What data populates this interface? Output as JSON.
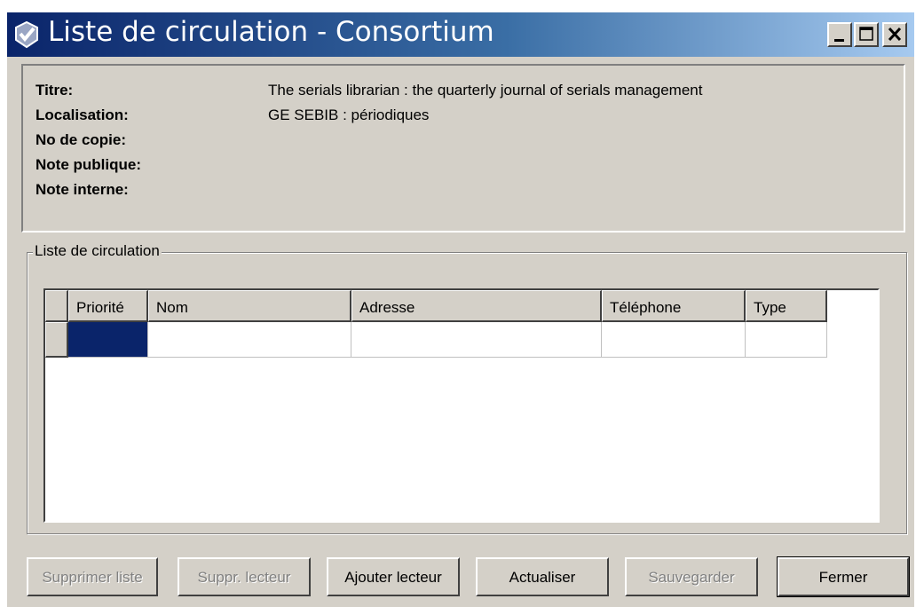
{
  "window": {
    "title": "Liste de circulation - Consortium"
  },
  "info": {
    "fields": [
      {
        "label": "Titre:",
        "value": "The serials librarian : the quarterly journal of serials management"
      },
      {
        "label": "Localisation:",
        "value": "GE SEBIB : périodiques"
      },
      {
        "label": "No de copie:",
        "value": ""
      },
      {
        "label": "Note publique:",
        "value": ""
      },
      {
        "label": "Note interne:",
        "value": ""
      }
    ]
  },
  "circulation": {
    "group_title": "Liste de circulation",
    "columns": [
      "Priorité",
      "Nom",
      "Adresse",
      "Téléphone",
      "Type"
    ],
    "rows": [
      [
        "",
        "",
        "",
        "",
        ""
      ]
    ],
    "selection_color": "#0a246a"
  },
  "buttons": [
    {
      "label": "Supprimer liste",
      "enabled": false
    },
    {
      "label": "Suppr. lecteur",
      "enabled": false
    },
    {
      "label": "Ajouter lecteur",
      "enabled": true
    },
    {
      "label": "Actualiser",
      "enabled": true
    },
    {
      "label": "Sauvegarder",
      "enabled": false
    },
    {
      "label": "Fermer",
      "enabled": true
    }
  ],
  "icons": {
    "app": "app-checkmark-icon",
    "minimize": "minimize-icon",
    "maximize": "maximize-icon",
    "close": "close-icon"
  }
}
